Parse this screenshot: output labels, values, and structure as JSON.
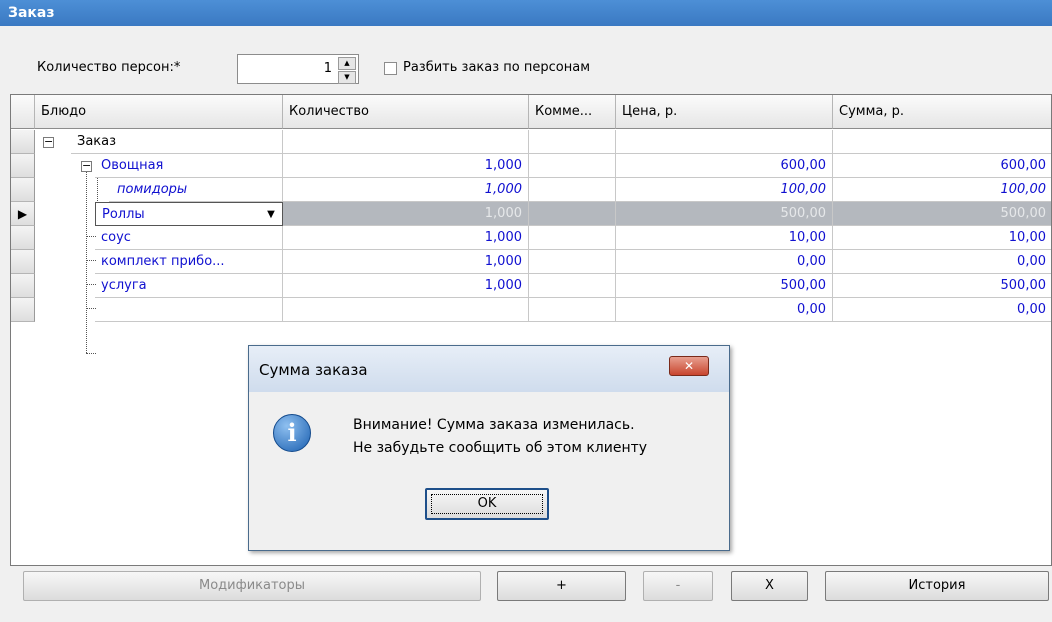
{
  "window": {
    "title": "Заказ"
  },
  "persons": {
    "label": "Количество персон:*",
    "value": "1"
  },
  "split_option": {
    "label": "Разбить заказ по персонам",
    "checked": false
  },
  "columns": {
    "dish": "Блюдо",
    "quantity": "Количество",
    "comment": "Комме...",
    "price": "Цена, р.",
    "sum": "Сумма, р."
  },
  "rows": [
    {
      "name": "Заказ",
      "quantity": "",
      "comment": "",
      "price": "",
      "sum": ""
    },
    {
      "name": "Овощная",
      "quantity": "1,000",
      "comment": "",
      "price": "600,00",
      "sum": "600,00"
    },
    {
      "name": "помидоры",
      "quantity": "1,000",
      "comment": "",
      "price": "100,00",
      "sum": "100,00"
    },
    {
      "name": "Роллы",
      "quantity": "1,000",
      "comment": "",
      "price": "500,00",
      "sum": "500,00"
    },
    {
      "name": "соус",
      "quantity": "1,000",
      "comment": "",
      "price": "10,00",
      "sum": "10,00"
    },
    {
      "name": "комплект прибо...",
      "quantity": "1,000",
      "comment": "",
      "price": "0,00",
      "sum": "0,00"
    },
    {
      "name": "услуга",
      "quantity": "1,000",
      "comment": "",
      "price": "500,00",
      "sum": "500,00"
    },
    {
      "name": "",
      "quantity": "",
      "comment": "",
      "price": "0,00",
      "sum": "0,00"
    }
  ],
  "buttons": {
    "modifiers": "Модификаторы",
    "plus": "+",
    "minus": "-",
    "x": "X",
    "history": "История"
  },
  "dialog": {
    "title": "Сумма заказа",
    "message_line1": "Внимание! Сумма заказа изменилась.",
    "message_line2": "Не забудьте сообщить об этом клиенту",
    "ok": "OK",
    "close": "✕"
  },
  "colors": {
    "title_bar": "#3a79c2",
    "item_text": "#1010d0",
    "selected_row": "#b4b8be",
    "dialog_close": "#c8452e"
  },
  "icons": {
    "collapse": "minus-box-icon",
    "dropdown": "chevron-down-icon",
    "row_pointer": "triangle-right-icon",
    "dialog": "info-icon"
  }
}
